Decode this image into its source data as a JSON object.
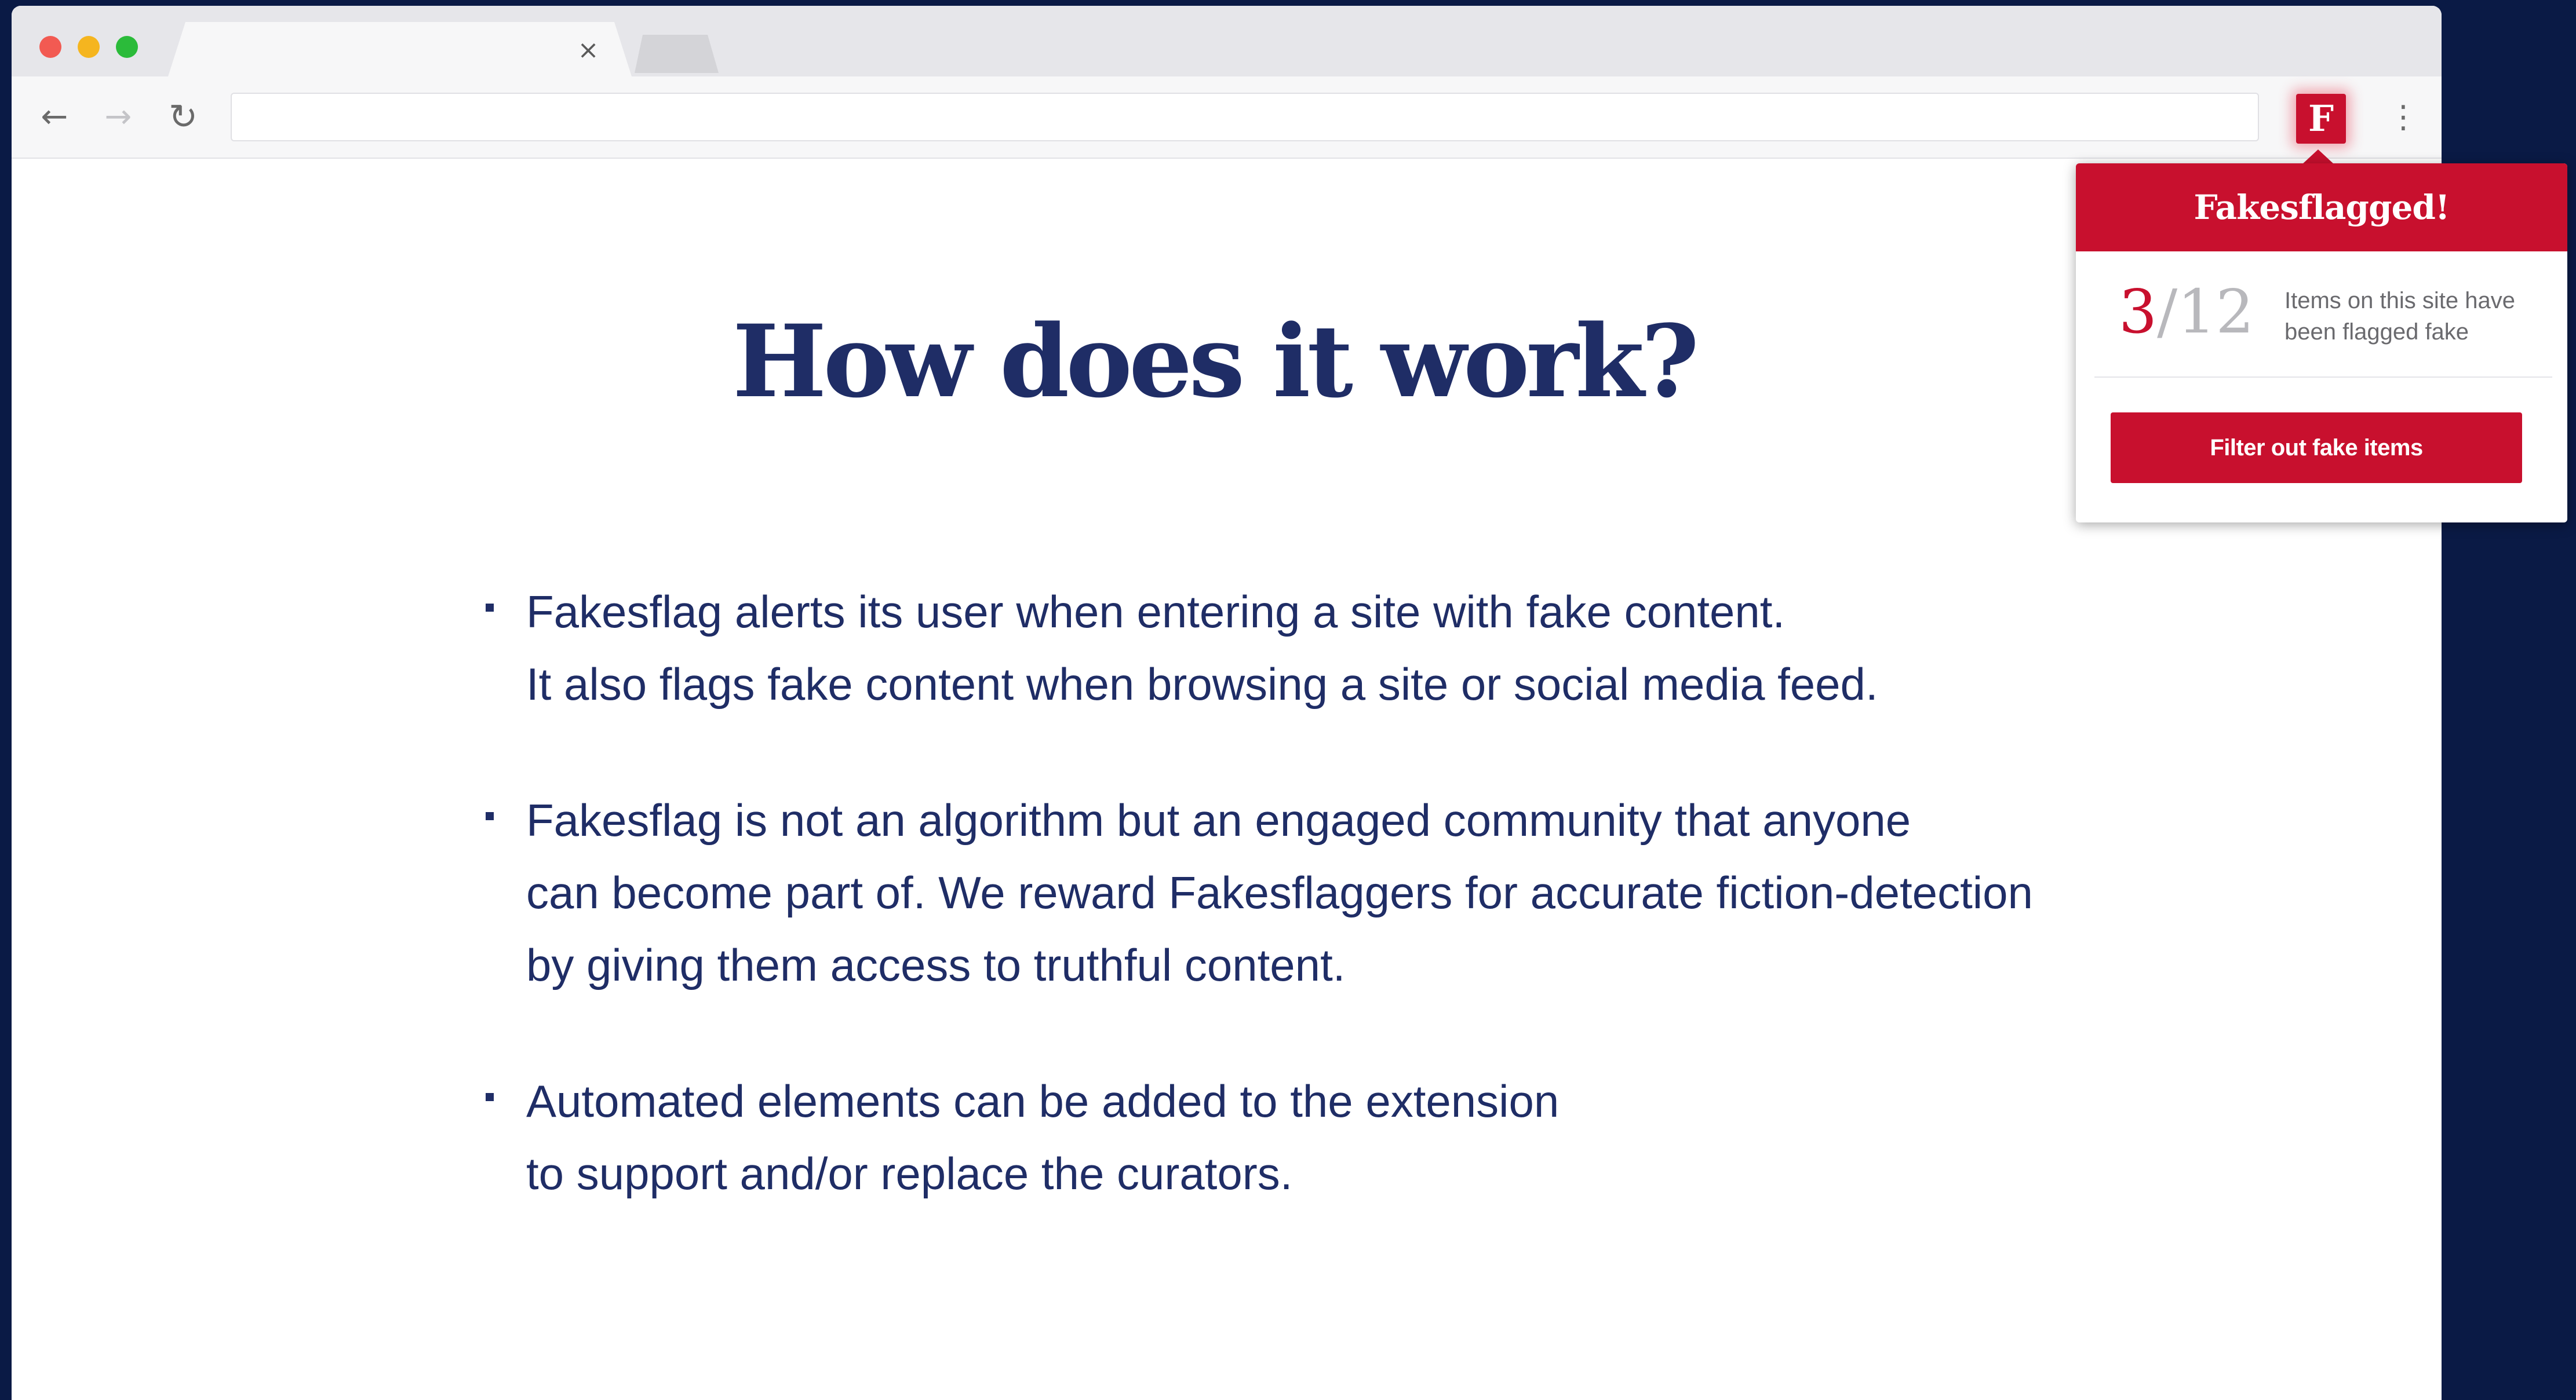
{
  "browser": {
    "tab_close_glyph": "×",
    "toolbar": {
      "back_glyph": "←",
      "forward_glyph": "→",
      "reload_glyph": "↻",
      "address_value": "",
      "extension_letter": "F",
      "menu_glyph": "⋮"
    }
  },
  "page": {
    "title": "How does it work?",
    "bullets": [
      {
        "lines": [
          "Fakesflag alerts its user when entering a site with fake content.",
          "It also flags fake content when browsing a site or social media feed."
        ]
      },
      {
        "lines": [
          "Fakesflag is not an algorithm but an engaged community that anyone",
          "can become part of. We reward Fakesflaggers for accurate fiction-detection",
          "by giving them access to truthful content."
        ]
      },
      {
        "lines": [
          "Automated elements can be added to the extension",
          "to support and/or replace the curators."
        ]
      }
    ]
  },
  "popup": {
    "title": "Fakesflagged!",
    "flagged_count": "3",
    "separator": "/",
    "total_count": "12",
    "description": "Items on this site have been flagged fake",
    "button_label": "Filter out fake items"
  },
  "colors": {
    "brand_red": "#c8102e",
    "navy": "#1f2d66",
    "backdrop": "#0a1a45"
  }
}
